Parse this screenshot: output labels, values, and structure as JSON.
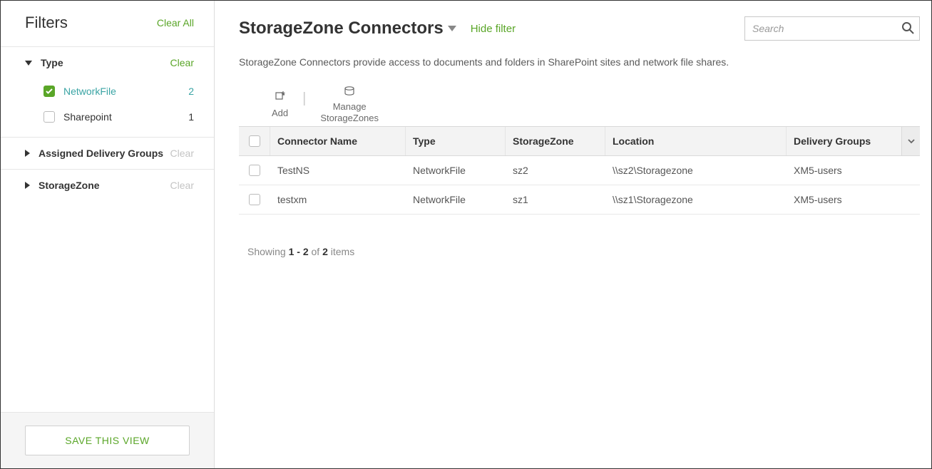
{
  "sidebar": {
    "title": "Filters",
    "clear_all": "Clear All",
    "save_view": "SAVE THIS VIEW",
    "sections": [
      {
        "name": "Type",
        "expanded": true,
        "clear_label": "Clear",
        "clear_enabled": true,
        "items": [
          {
            "label": "NetworkFile",
            "count": "2",
            "checked": true
          },
          {
            "label": "Sharepoint",
            "count": "1",
            "checked": false
          }
        ]
      },
      {
        "name": "Assigned Delivery Groups",
        "expanded": false,
        "clear_label": "Clear",
        "clear_enabled": false
      },
      {
        "name": "StorageZone",
        "expanded": false,
        "clear_label": "Clear",
        "clear_enabled": false
      }
    ]
  },
  "header": {
    "title": "StorageZone Connectors",
    "hide_filter": "Hide filter",
    "search_placeholder": "Search"
  },
  "description": "StorageZone Connectors provide access to documents and folders in SharePoint sites and network file shares.",
  "toolbar": {
    "add": "Add",
    "manage": "Manage\nStorageZones"
  },
  "table": {
    "columns": {
      "name": "Connector Name",
      "type": "Type",
      "storagezone": "StorageZone",
      "location": "Location",
      "delivery_groups": "Delivery Groups"
    },
    "rows": [
      {
        "name": "TestNS",
        "type": "NetworkFile",
        "storagezone": "sz2",
        "location": "\\\\sz2\\Storagezone",
        "delivery_groups": "XM5-users"
      },
      {
        "name": "testxm",
        "type": "NetworkFile",
        "storagezone": "sz1",
        "location": "\\\\sz1\\Storagezone",
        "delivery_groups": "XM5-users"
      }
    ]
  },
  "pagination": {
    "prefix": "Showing ",
    "range": "1 - 2",
    "mid": " of ",
    "total": "2",
    "suffix": " items"
  }
}
